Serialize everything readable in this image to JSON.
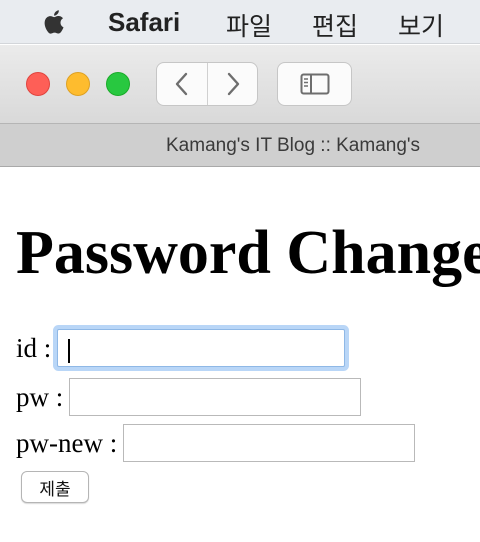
{
  "menubar": {
    "app_name": "Safari",
    "items": [
      "파일",
      "편집",
      "보기"
    ]
  },
  "browser": {
    "tab_title": "Kamang's IT Blog :: Kamang's"
  },
  "page": {
    "title": "Password Change",
    "form": {
      "id_label": "id :",
      "pw_label": "pw :",
      "pw_new_label": "pw-new :",
      "id_value": "",
      "pw_value": "",
      "pw_new_value": "",
      "submit_label": "제출"
    }
  },
  "colors": {
    "close": "#fe5f57",
    "minimize": "#febc2e",
    "zoom": "#28c840",
    "focus_ring": "#b9d6f7"
  },
  "icons": [
    "apple-icon",
    "back-chevron-icon",
    "forward-chevron-icon",
    "sidebar-icon"
  ]
}
